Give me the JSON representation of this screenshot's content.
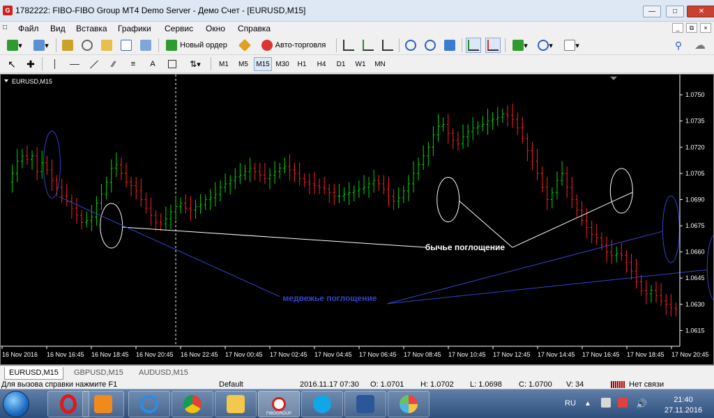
{
  "window": {
    "title": "1782222: FIBO-FIBO Group MT4 Demo Server - Демо Счет - [EURUSD,M15]",
    "icon_letter": "G"
  },
  "menu": [
    "Файл",
    "Вид",
    "Вставка",
    "Графики",
    "Сервис",
    "Окно",
    "Справка"
  ],
  "toolbar": {
    "new_order": "Новый ордер",
    "autotrading": "Авто-торговля",
    "text_tool": "A"
  },
  "timeframes": {
    "items": [
      "M1",
      "M5",
      "M15",
      "M30",
      "H1",
      "H4",
      "D1",
      "W1",
      "MN"
    ],
    "active": "M15"
  },
  "chart": {
    "label": "EURUSD,M15",
    "bullish_annotation": "бычье поглощение",
    "bearish_annotation": "медвежье поглощение",
    "colors": {
      "background": "#000000",
      "bull": "#00dd00",
      "bear": "#ff2222",
      "bull_ellipse": "#ffffff",
      "bear_ellipse": "#3344cc",
      "bear_text": "#3344cc",
      "axis_text": "#ffffff"
    }
  },
  "chart_data": {
    "type": "ohlc",
    "symbol": "EURUSD",
    "timeframe": "M15",
    "y_ticks": [
      "1.0750",
      "1.0735",
      "1.0720",
      "1.0705",
      "1.0690",
      "1.0675",
      "1.0660",
      "1.0645",
      "1.0630",
      "1.0615"
    ],
    "ylim": [
      1.0606,
      1.076
    ],
    "x_ticks": [
      "16 Nov 2016",
      "16 Nov 16:45",
      "16 Nov 18:45",
      "16 Nov 20:45",
      "16 Nov 22:45",
      "17 Nov 00:45",
      "17 Nov 02:45",
      "17 Nov 04:45",
      "17 Nov 06:45",
      "17 Nov 08:45",
      "17 Nov 10:45",
      "17 Nov 12:45",
      "17 Nov 14:45",
      "17 Nov 16:45",
      "17 Nov 18:45",
      "17 Nov 20:45"
    ],
    "price_path": [
      1.07,
      1.0705,
      1.0712,
      1.0715,
      1.0713,
      1.0715,
      1.0706,
      1.0711,
      1.0707,
      1.0701,
      1.0697,
      1.0692,
      1.0689,
      1.0685,
      1.0681,
      1.0677,
      1.0678,
      1.068,
      1.0688,
      1.0693,
      1.07,
      1.0708,
      1.071,
      1.0705,
      1.07,
      1.0698,
      1.0695,
      1.069,
      1.0685,
      1.0681,
      1.0677,
      1.0676,
      1.0679,
      1.0683,
      1.0686,
      1.0688,
      1.0685,
      1.0684,
      1.0686,
      1.0687,
      1.069,
      1.0691,
      1.0693,
      1.0697,
      1.0699,
      1.0701,
      1.0703,
      1.0704,
      1.0706,
      1.0708,
      1.0706,
      1.0704,
      1.0702,
      1.0704,
      1.0706,
      1.0708,
      1.0709,
      1.0707,
      1.0705,
      1.0702,
      1.07,
      1.0699,
      1.0698,
      1.0697,
      1.0696,
      1.0694,
      1.0692,
      1.0692,
      1.0693,
      1.0694,
      1.0695,
      1.0696,
      1.0697,
      1.0699,
      1.0701,
      1.0699,
      1.0696,
      1.0692,
      1.0689,
      1.0691,
      1.0695,
      1.0699,
      1.0705,
      1.071,
      1.0715,
      1.072,
      1.0727,
      1.0732,
      1.0733,
      1.0728,
      1.0724,
      1.0722,
      1.0726,
      1.0729,
      1.0731,
      1.0732,
      1.0733,
      1.0735,
      1.0736,
      1.0737,
      1.0739,
      1.0738,
      1.0736,
      1.0731,
      1.0725,
      1.0718,
      1.0712,
      1.0705,
      1.0697,
      1.069,
      1.0694,
      1.0701,
      1.0705,
      1.0697,
      1.069,
      1.0684,
      1.0678,
      1.0674,
      1.067,
      1.0668,
      1.0664,
      1.066,
      1.0658,
      1.0659,
      1.0658,
      1.0654,
      1.0649,
      1.0643,
      1.0638,
      1.0636,
      1.0638,
      1.0635,
      1.0632,
      1.063,
      1.0628,
      1.0627
    ],
    "bull_engulfing": [
      [
        21,
        1.0675
      ],
      [
        89,
        1.069
      ],
      [
        124,
        1.0695
      ]
    ],
    "bear_engulfing": [
      [
        9,
        1.071
      ],
      [
        134,
        1.0673
      ],
      [
        143,
        1.0651
      ]
    ],
    "bullish_annotation_price": 1.0661,
    "bearish_annotation_price": 1.0632,
    "cursor_index": 34
  },
  "tabs": [
    {
      "label": "EURUSD,M15",
      "active": true
    },
    {
      "label": "GBPUSD,M15",
      "active": false
    },
    {
      "label": "AUDUSD,M15",
      "active": false
    }
  ],
  "status": {
    "help": "Для вызова справки нажмите F1",
    "profile": "Default",
    "time": "2016.11.17 07:30",
    "open": "O: 1.0701",
    "high": "H: 1.0702",
    "low": "L: 1.0698",
    "close": "C: 1.0700",
    "volume": "V: 34",
    "connection": "Нет связи"
  },
  "taskbar": {
    "apps": [
      "opera",
      "media-player",
      "internet-explorer",
      "chrome",
      "file-explorer",
      "fibo-group",
      "skype",
      "word",
      "paint"
    ],
    "fibo_label": "FIBOGROUP",
    "lang": "RU",
    "time": "21:40",
    "date": "27.11.2016"
  }
}
